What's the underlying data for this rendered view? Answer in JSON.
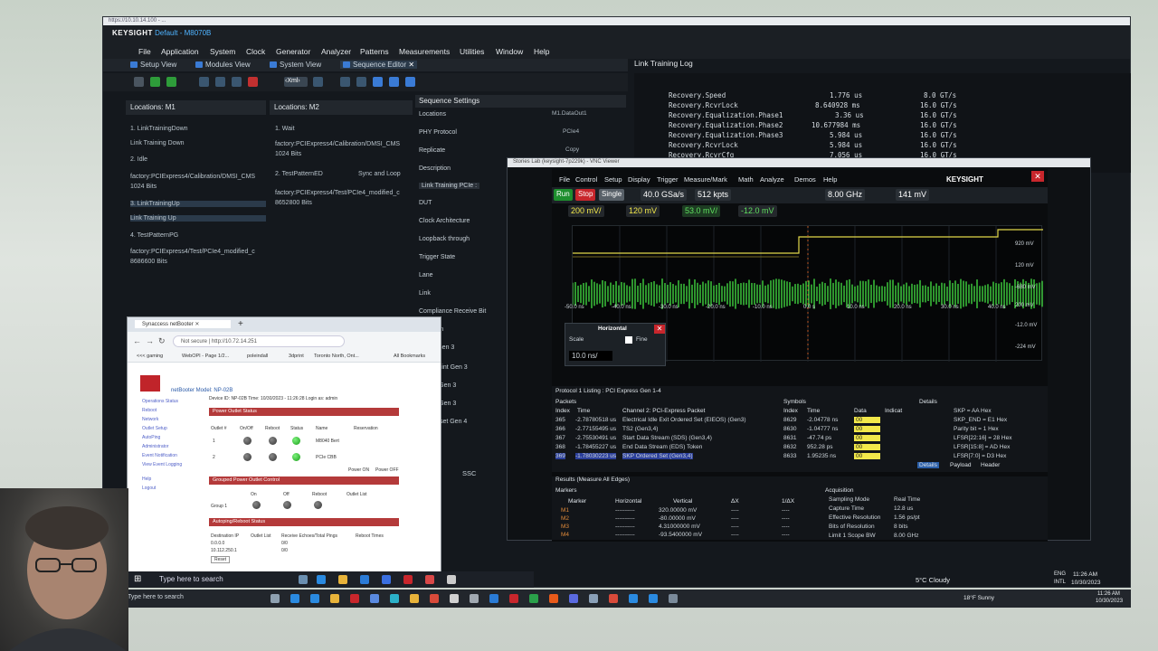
{
  "app": {
    "window_title": "https://10.10.14.100 - ...",
    "brand": "KEYSIGHT",
    "config": "Default - M8070B"
  },
  "menu": [
    "File",
    "Application",
    "System",
    "Clock",
    "Generator",
    "Analyzer",
    "Patterns",
    "Measurements",
    "Utilities",
    "Window",
    "Help"
  ],
  "view_tabs": [
    "Setup View",
    "Modules View",
    "System View",
    "Sequence Editor"
  ],
  "locations_m1": {
    "title": "Locations: M1",
    "items": [
      "1. LinkTrainingDown",
      "Link Training  Down",
      "2. Idle",
      "factory:PCIExpress4/Calibration/DMSI_CMS",
      "1024 Bits",
      "3. LinkTrainingUp",
      "Link Training  Up",
      "4. TestPatternPG",
      "factory:PCIExpress4/Test/PCIe4_modified_c",
      "8686600 Bits"
    ]
  },
  "locations_m2": {
    "title": "Locations: M2",
    "items": [
      "1. Wait",
      "factory:PCIExpress4/Calibration/DMSI_CMS",
      "1024 Bits",
      "2. TestPatternED",
      "Sync and Loop",
      "factory:PCIExpress4/Test/PCIe4_modified_c",
      "8652800 Bits"
    ]
  },
  "sequence_settings": {
    "title": "Sequence Settings",
    "rows": [
      "Locations",
      "PHY Protocol",
      "Replicate",
      "Description",
      "Link Training PCIe :",
      "DUT",
      "Clock Architecture",
      "Loopback through",
      "Trigger State",
      "Lane",
      "Link",
      "Compliance Receive Bit",
      "ialization",
      "Reset Gen 3",
      "Reset Hint Gen 3",
      "Preset Gen 3",
      "Preset Gen 3",
      "Preset Gen 3",
      "tart Preset Gen 4"
    ],
    "values": {
      "locations": "M1.DataOut1",
      "phy": "PCIe4",
      "replicate": "Copy"
    },
    "footer": "SSC"
  },
  "link_log": {
    "title": "Link Training Log",
    "lines": [
      {
        "name": "Recovery.Speed",
        "time": "1.776 us",
        "rate": "8.0 GT/s"
      },
      {
        "name": "Recovery.RcvrLock",
        "time": "8.640928 ms",
        "rate": "16.0 GT/s"
      },
      {
        "name": "Recovery.Equalization.Phase1",
        "time": "3.36 us",
        "rate": "16.0 GT/s"
      },
      {
        "name": "Recovery.Equalization.Phase2",
        "time": "10.677984 ms",
        "rate": "16.0 GT/s"
      },
      {
        "name": "Recovery.Equalization.Phase3",
        "time": "5.984 us",
        "rate": "16.0 GT/s"
      },
      {
        "name": "Recovery.RcvrLock",
        "time": "5.984 us",
        "rate": "16.0 GT/s"
      },
      {
        "name": "Recovery.RcvrCfg",
        "time": "7.056 us",
        "rate": "16.0 GT/s"
      }
    ]
  },
  "vnc": {
    "title": "Stories Lab (keysight-7p229k) - VNC Viewer",
    "scope_menu": [
      "File",
      "Control",
      "Setup",
      "Display",
      "Trigger",
      "Measure/Mark",
      "Math",
      "Analyze",
      "Demos",
      "Help"
    ],
    "brand": "KEYSIGHT",
    "sample_rate": "40.0 GSa/s",
    "points": "512 kpts",
    "clock": "8.00 GHz",
    "trigger_level": "141 mV",
    "ch1_scale": "200 mV/",
    "ch1_offset": "120 mV",
    "ch2_scale": "53.0 mV/",
    "ch2_offset": "-12.0 mV",
    "run": "Run",
    "stop": "Stop",
    "single": "Single",
    "x_ticks": [
      "-50.0 ns",
      "-40.0 ns",
      "-30.0 ns",
      "-20.0 ns",
      "-10.0 ns",
      "0.0 s",
      "10.0 ns",
      "20.0 ns",
      "30.0 ns",
      "40.0 ns",
      "50.0 ns"
    ],
    "right_labels": [
      "920 mV",
      "120 mV",
      "-680 mV",
      "200 mV",
      "-12.0 mV",
      "-224 mV"
    ],
    "horizontal": {
      "title": "Horizontal",
      "scale_label": "Scale",
      "fine": "Fine",
      "value": "10.0 ns/"
    },
    "listing_title": "Protocol 1 Listing : PCI Express Gen 1-4",
    "packets_head": [
      "Packets",
      "Index",
      "Time",
      "Channel 2: PCI-Express Packet"
    ],
    "packets": [
      {
        "idx": "365",
        "time": "-2.78780518 us",
        "pkt": "Electrical Idle Exit Ordered Set (EIEOS) (Gen3)"
      },
      {
        "idx": "366",
        "time": "-2.77155495 us",
        "pkt": "TS2 (Gen3,4)"
      },
      {
        "idx": "367",
        "time": "-2.75530491 us",
        "pkt": "Start Data Stream (SDS) (Gen3,4)"
      },
      {
        "idx": "368",
        "time": "-1.78455227 us",
        "pkt": "End Data Stream (EDS) Token"
      },
      {
        "idx": "369",
        "time": "-1.78030223 us",
        "pkt": "SKP Ordered Set (Gen3,4)"
      }
    ],
    "symbols_head": [
      "Symbols",
      "Index",
      "Time",
      "Data",
      "Indicat"
    ],
    "symbols": [
      {
        "idx": "8629",
        "time": "-2.04778 ns",
        "data": "00"
      },
      {
        "idx": "8630",
        "time": "-1.04777 ns",
        "data": "00"
      },
      {
        "idx": "8631",
        "time": "-47.74 ps",
        "data": "00"
      },
      {
        "idx": "8632",
        "time": "952.28 ps",
        "data": "00"
      },
      {
        "idx": "8633",
        "time": "1.95235 ns",
        "data": "00"
      }
    ],
    "details_head": "Details",
    "details": [
      "SKP = AA Hex",
      "SKP_END = E1 Hex",
      "Parity bit = 1 Hex",
      "LFSR[22:16] = 28 Hex",
      "LFSR[15:8] = AD Hex",
      "LFSR[7:0] = D3 Hex"
    ],
    "details_tabs": [
      "Details",
      "Payload",
      "Header"
    ],
    "results_title": "Results  (Measure All Edges)",
    "markers_head": [
      "Markers",
      "Marker",
      "Horizontal",
      "Vertical",
      "ΔX",
      "1/ΔX"
    ],
    "markers": [
      {
        "m": "M1",
        "h": "----------",
        "v": "320.00000 mV",
        "dx": "----",
        "idx": "----"
      },
      {
        "m": "M2",
        "h": "----------",
        "v": "-80.00000 mV",
        "dx": "----",
        "idx": "----"
      },
      {
        "m": "M3",
        "h": "----------",
        "v": "4.31000000 mV",
        "dx": "----",
        "idx": "----"
      },
      {
        "m": "M4",
        "h": "----------",
        "v": "-93.5400000 mV",
        "dx": "----",
        "idx": "----"
      }
    ],
    "acq_head": "Acquisition",
    "acq": [
      {
        "k": "Sampling Mode",
        "v": "Real Time"
      },
      {
        "k": "Capture Time",
        "v": "12.8 us"
      },
      {
        "k": "Effective Resolution",
        "v": "1.56 ps/pt"
      },
      {
        "k": "Bits of Resolution",
        "v": "8 bits"
      },
      {
        "k": "Limit 1 Scope BW",
        "v": "8.00 GHz"
      }
    ]
  },
  "browser": {
    "tab": "Synaccess netBooter",
    "not_secure": "Not secure",
    "url": "http://10.72.14.251",
    "bookmarks": [
      "<<< gaming",
      "WebOPI - Page 1/2...",
      "poleindall",
      "3dprint",
      "Toronto North, Ont...",
      "All Bookmarks"
    ],
    "model": "netBooter Model: NP-02B",
    "device_id": "Device ID: NP-02B  Time: 10/30/2023 - 11:26:28  Login as: admin",
    "side_links": [
      "Operations Status",
      "Reboot",
      "Network",
      "Outlet Setup",
      "AutoPing",
      "Administrator",
      "Event Notification",
      "View Event Logging",
      "Help",
      "Logout"
    ],
    "power_title": "Power Outlet Status",
    "cols": [
      "Outlet #",
      "On/Off",
      "Reboot",
      "Status",
      "Name",
      "Reservation"
    ],
    "outlets": [
      {
        "n": "1",
        "name": "M8040 Bert"
      },
      {
        "n": "2",
        "name": "PCIe CBB"
      }
    ],
    "legend": [
      "Power ON",
      "Power OFF"
    ],
    "grouped_title": "Grouped Power Outlet Control",
    "group_cols": [
      "On",
      "Off",
      "Reboot",
      "Outlet List"
    ],
    "group_row": "Group 1",
    "autoping_title": "Autoping/Reboot Status",
    "autoping_cols": [
      "Destination IP",
      "Outlet List",
      "Receive Echoes/Total Pings",
      "Reboot Times"
    ],
    "autoping_rows": [
      {
        "ip": "0.0.0.0",
        "ol": "0/0"
      },
      {
        "ip": "10.112.250.1",
        "ol": "0/0"
      }
    ],
    "reset": "Reset"
  },
  "inner_taskbar": {
    "search": "Type here to search"
  },
  "outer_taskbar": {
    "search": "Type here to search",
    "weather": "18°F Sunny",
    "time": "11:26 AM",
    "date": "10/30/2023"
  },
  "inner_tray": {
    "weather": "5°C  Cloudy",
    "lang": "ENG",
    "region": "INTL",
    "time": "11:26 AM",
    "date": "10/30/2023"
  }
}
